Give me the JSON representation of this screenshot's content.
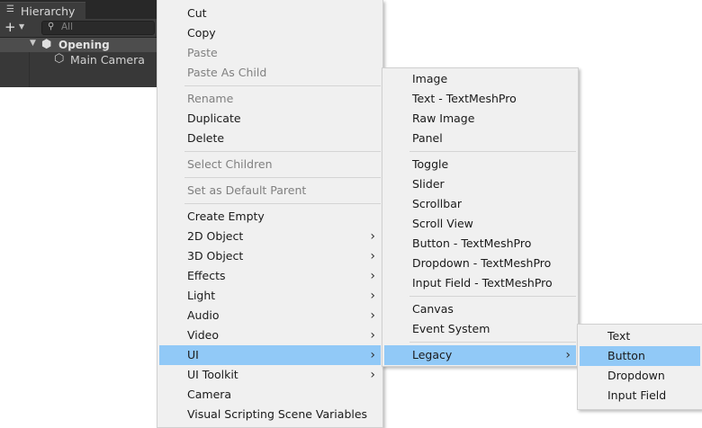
{
  "hierarchy": {
    "tab_label": "Hierarchy",
    "add_icon": "+",
    "search_placeholder": "All",
    "scene_name": "Opening",
    "child_name": "Main Camera"
  },
  "context_menu": {
    "cut": "Cut",
    "copy": "Copy",
    "paste": "Paste",
    "paste_as_child": "Paste As Child",
    "rename": "Rename",
    "duplicate": "Duplicate",
    "delete": "Delete",
    "select_children": "Select Children",
    "set_default_parent": "Set as Default Parent",
    "create_empty": "Create Empty",
    "object_2d": "2D Object",
    "object_3d": "3D Object",
    "effects": "Effects",
    "light": "Light",
    "audio": "Audio",
    "video": "Video",
    "ui": "UI",
    "ui_toolkit": "UI Toolkit",
    "camera": "Camera",
    "visual_scripting": "Visual Scripting Scene Variables"
  },
  "ui_submenu": {
    "image": "Image",
    "text_tmp": "Text - TextMeshPro",
    "raw_image": "Raw Image",
    "panel": "Panel",
    "toggle": "Toggle",
    "slider": "Slider",
    "scrollbar": "Scrollbar",
    "scroll_view": "Scroll View",
    "button_tmp": "Button - TextMeshPro",
    "dropdown_tmp": "Dropdown - TextMeshPro",
    "input_field_tmp": "Input Field - TextMeshPro",
    "canvas": "Canvas",
    "event_system": "Event System",
    "legacy": "Legacy"
  },
  "legacy_submenu": {
    "text": "Text",
    "button": "Button",
    "dropdown": "Dropdown",
    "input_field": "Input Field"
  },
  "colors": {
    "highlight": "#91c9f7",
    "menu_bg": "#f0f0f0",
    "panel_bg": "#383838"
  }
}
